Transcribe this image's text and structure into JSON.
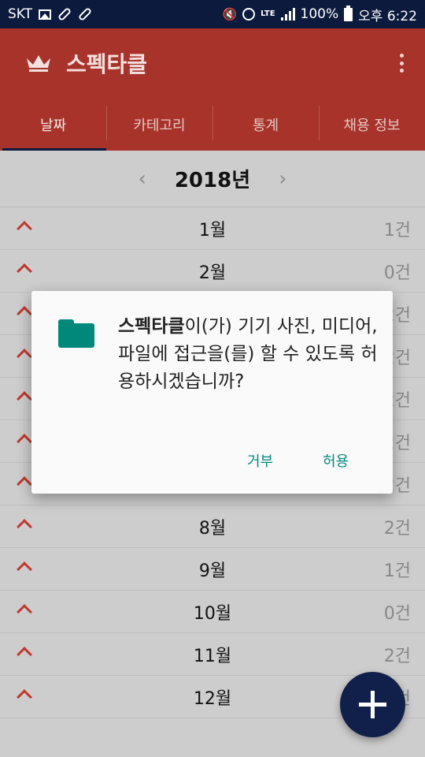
{
  "status_bar": {
    "carrier": "SKT",
    "icons": [
      "photo-icon",
      "pill-icon",
      "pill-icon",
      "mute-icon",
      "alarm-icon",
      "lte-icon",
      "signal-icon",
      "battery-icon"
    ],
    "lte": "LTE",
    "battery": "100%",
    "time": "오후 6:22"
  },
  "app_bar": {
    "title": "스펙타클",
    "color": "#a8332b"
  },
  "tabs": [
    {
      "label": "날짜",
      "active": true
    },
    {
      "label": "카테고리",
      "active": false
    },
    {
      "label": "통계",
      "active": false
    },
    {
      "label": "채용 정보",
      "active": false
    }
  ],
  "year_selector": {
    "prev": "‹",
    "year": "2018년",
    "next": "›"
  },
  "months": [
    {
      "month": "1월",
      "count": "1건"
    },
    {
      "month": "2월",
      "count": "0건"
    },
    {
      "month": "",
      "count": "2건"
    },
    {
      "month": "",
      "count": "2건"
    },
    {
      "month": "",
      "count": "2건"
    },
    {
      "month": "",
      "count": "2건"
    },
    {
      "month": "",
      "count": "2건"
    },
    {
      "month": "8월",
      "count": "2건"
    },
    {
      "month": "9월",
      "count": "1건"
    },
    {
      "month": "10월",
      "count": "0건"
    },
    {
      "month": "11월",
      "count": "2건"
    },
    {
      "month": "12월",
      "count": "2건"
    }
  ],
  "dialog": {
    "app_name": "스펙타클",
    "message": "이(가) 기기 사진, 미디어, 파일에 접근을(를) 할 수 있도록 허용하시겠습니까?",
    "deny": "거부",
    "allow": "허용",
    "accent": "#00897b"
  },
  "fab": {
    "icon": "plus-icon",
    "color": "#10204a"
  }
}
